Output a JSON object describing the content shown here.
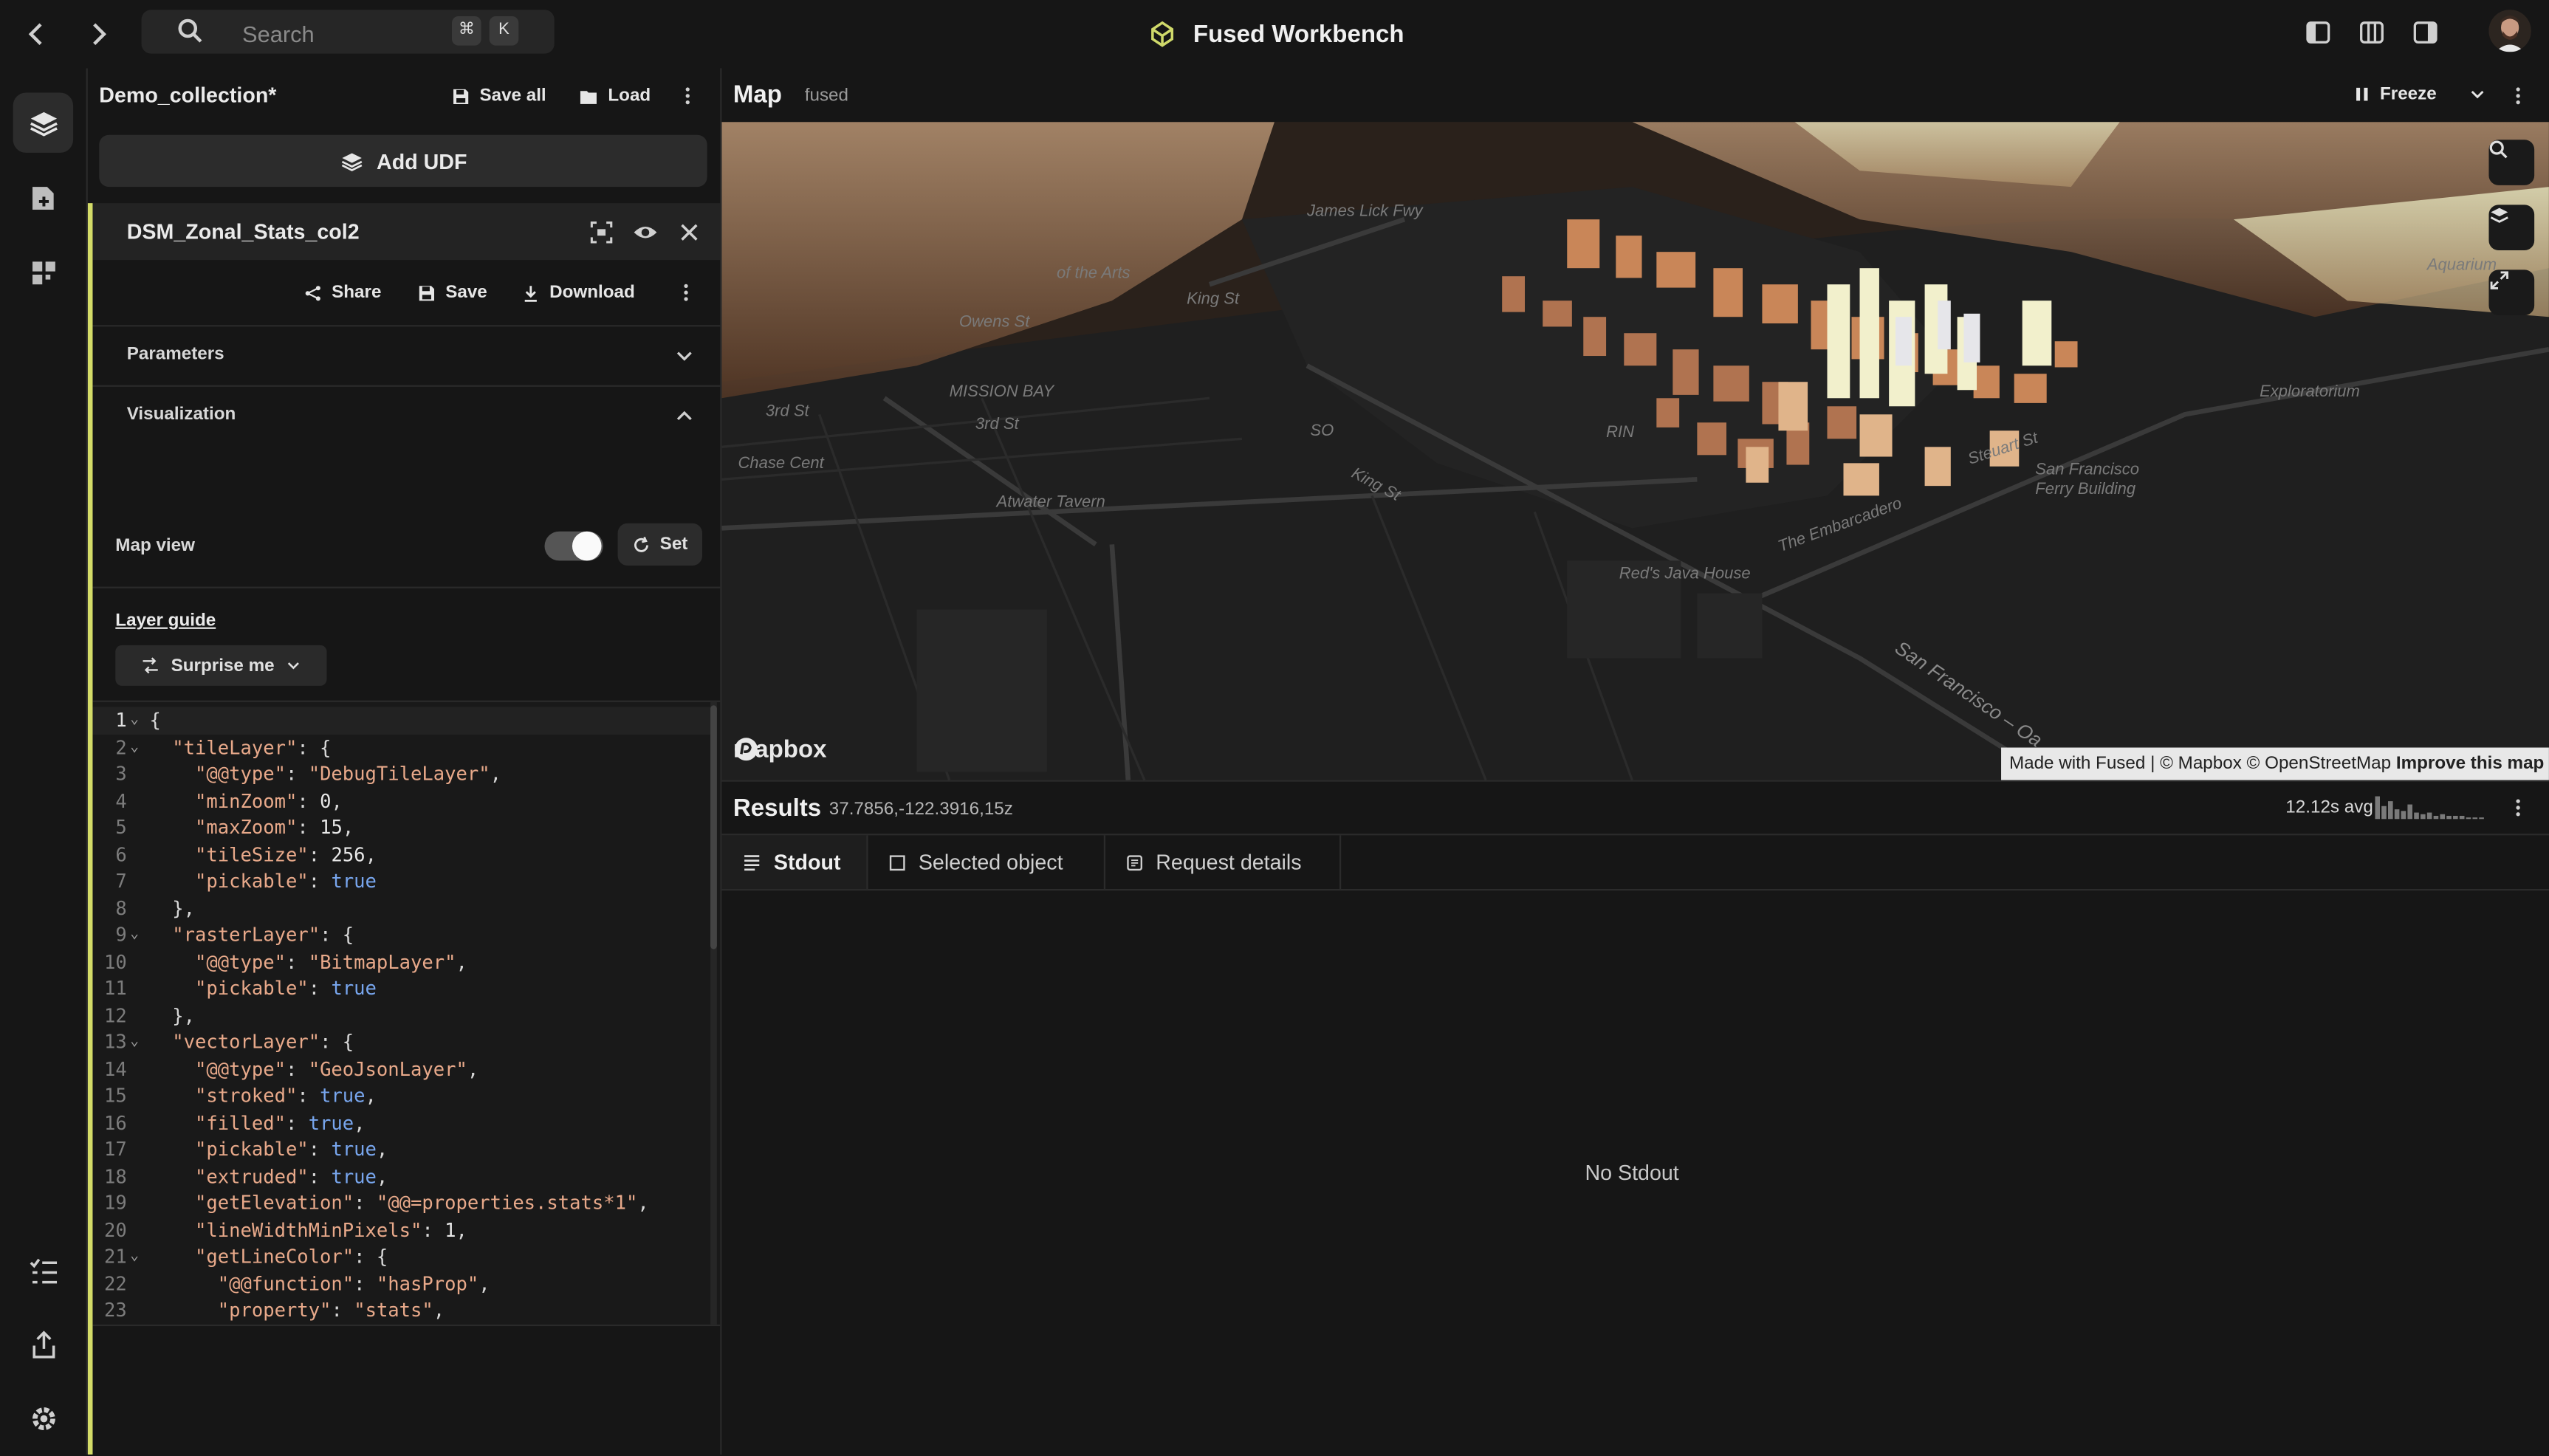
{
  "topbar": {
    "search_placeholder": "Search",
    "shortcut_key1": "⌘",
    "shortcut_key2": "K",
    "app_title": "Fused Workbench"
  },
  "collection": {
    "name": "Demo_collection*",
    "save_all": "Save all",
    "load": "Load",
    "add_udf": "Add UDF"
  },
  "udf": {
    "name": "DSM_Zonal_Stats_col2",
    "share": "Share",
    "save": "Save",
    "download": "Download",
    "parameters": "Parameters",
    "visualization": "Visualization",
    "map_view_label": "Map view",
    "map_view_on": true,
    "set_label": "Set",
    "layer_guide": "Layer guide",
    "surprise_me": "Surprise me"
  },
  "code_lines": [
    "{",
    "  \"tileLayer\": {",
    "    \"@@type\": \"DebugTileLayer\",",
    "    \"minZoom\": 0,",
    "    \"maxZoom\": 15,",
    "    \"tileSize\": 256,",
    "    \"pickable\": true",
    "  },",
    "  \"rasterLayer\": {",
    "    \"@@type\": \"BitmapLayer\",",
    "    \"pickable\": true",
    "  },",
    "  \"vectorLayer\": {",
    "    \"@@type\": \"GeoJsonLayer\",",
    "    \"stroked\": true,",
    "    \"filled\": true,",
    "    \"pickable\": true,",
    "    \"extruded\": true,",
    "    \"getElevation\": \"@@=properties.stats*1\",",
    "    \"lineWidthMinPixels\": 1,",
    "    \"getLineColor\": {",
    "      \"@@function\": \"hasProp\",",
    "      \"property\": \"stats\","
  ],
  "map": {
    "title": "Map",
    "subtitle": "fused",
    "freeze": "Freeze",
    "logo_text": "mapbox",
    "attribution_prefix": "Made with Fused | © Mapbox © OpenStreetMap",
    "attribution_link": "Improve this map",
    "labels": {
      "the_arts": "of the Arts",
      "king_st": "King St",
      "mission_bay": "MISSION BAY",
      "third_st": "3rd St",
      "third_st_2": "3rd St",
      "chase_center": "Chase Cent",
      "atwater": "Atwater Tavern",
      "king_st_2": "King St",
      "embarcadero": "The Embarcadero",
      "reds_java": "Red's Java House",
      "sf_oakland": "San Francisco – Oa",
      "ferry_building": "San Francisco Ferry Building",
      "exploratorium": "Exploratorium",
      "steuart_st": "Steuart St",
      "aquarium": "Aquarium",
      "rincon": "RIN",
      "so": "SO",
      "james_lick": "James Lick Fwy",
      "owens_st": "Owens St"
    }
  },
  "results": {
    "title": "Results",
    "coords": "37.7856,-122.3916,15z",
    "avg": "12.12s avg",
    "tabs": [
      "Stdout",
      "Selected object",
      "Request details"
    ],
    "empty": "No Stdout"
  },
  "colors": {
    "accent_border": "#d4dc68",
    "string": "#e8a98a",
    "boolean": "#78a6ee"
  }
}
